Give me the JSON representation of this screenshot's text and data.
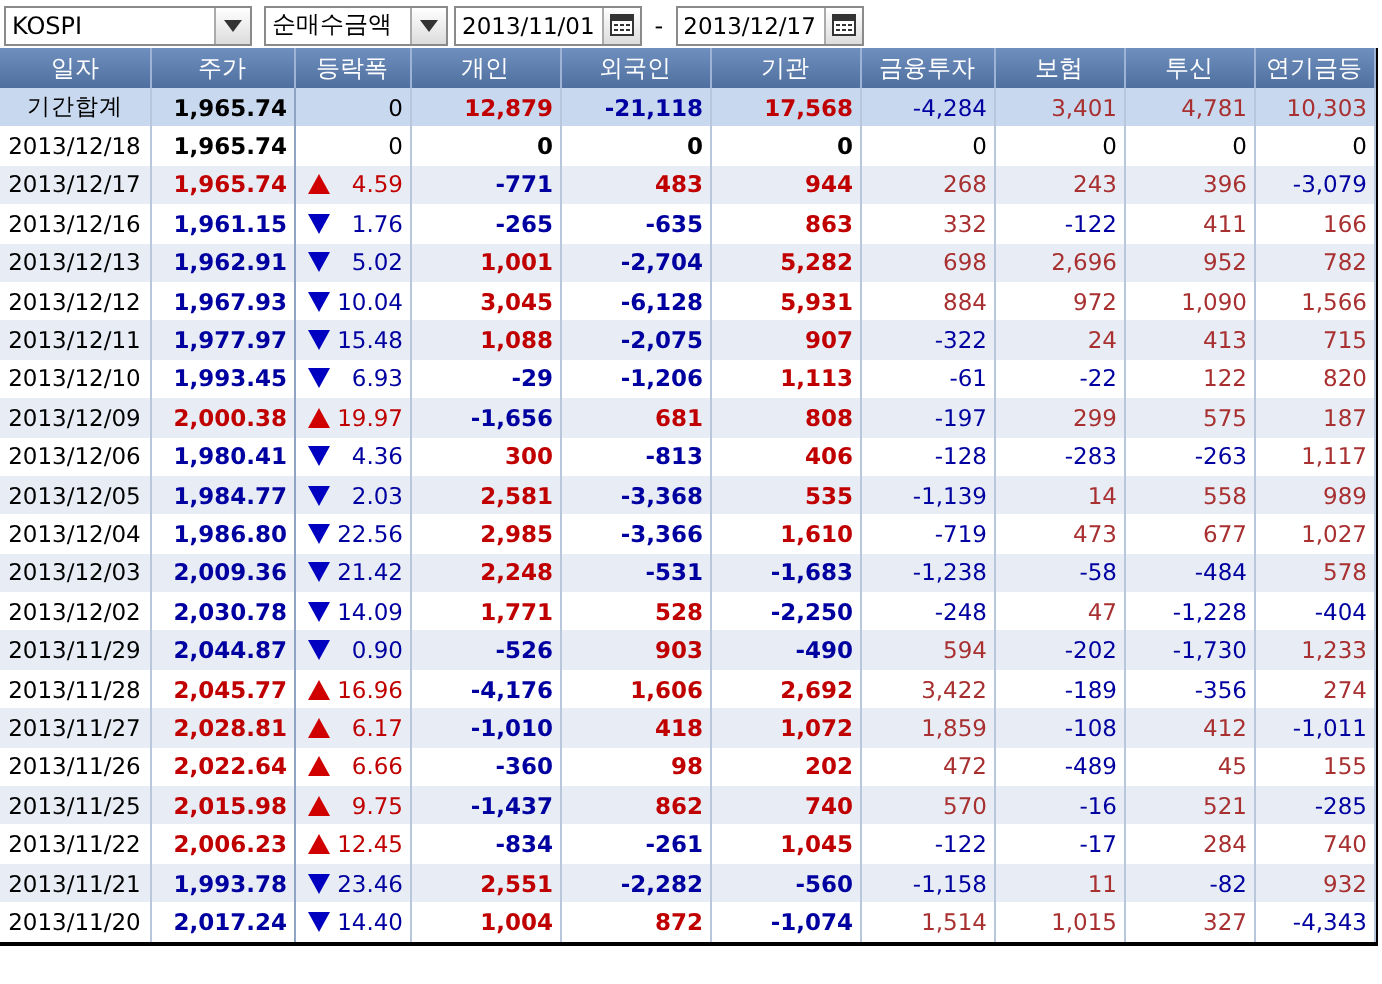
{
  "toolbar": {
    "market": "KOSPI",
    "measure": "순매수금액",
    "start_date": "2013/11/01",
    "separator": "-",
    "end_date": "2013/12/17"
  },
  "table": {
    "columns": [
      "일자",
      "주가",
      "등락폭",
      "개인",
      "외국인",
      "기관",
      "금융투자",
      "보험",
      "투신",
      "연기금등"
    ],
    "summary": {
      "label": "기간합계",
      "price": "1,965.74",
      "change": "0",
      "values": [
        "12,879",
        "-21,118",
        "17,568",
        "-4,284",
        "3,401",
        "4,781",
        "10,303"
      ]
    },
    "rows": [
      {
        "date": "2013/12/18",
        "price": "1,965.74",
        "kind": "flat",
        "change": "0",
        "values": [
          "0",
          "0",
          "0",
          "0",
          "0",
          "0",
          "0"
        ]
      },
      {
        "date": "2013/12/17",
        "price": "1,965.74",
        "kind": "up",
        "change": "4.59",
        "values": [
          "-771",
          "483",
          "944",
          "268",
          "243",
          "396",
          "-3,079"
        ]
      },
      {
        "date": "2013/12/16",
        "price": "1,961.15",
        "kind": "down",
        "change": "1.76",
        "values": [
          "-265",
          "-635",
          "863",
          "332",
          "-122",
          "411",
          "166"
        ]
      },
      {
        "date": "2013/12/13",
        "price": "1,962.91",
        "kind": "down",
        "change": "5.02",
        "values": [
          "1,001",
          "-2,704",
          "5,282",
          "698",
          "2,696",
          "952",
          "782"
        ]
      },
      {
        "date": "2013/12/12",
        "price": "1,967.93",
        "kind": "down",
        "change": "10.04",
        "values": [
          "3,045",
          "-6,128",
          "5,931",
          "884",
          "972",
          "1,090",
          "1,566"
        ]
      },
      {
        "date": "2013/12/11",
        "price": "1,977.97",
        "kind": "down",
        "change": "15.48",
        "values": [
          "1,088",
          "-2,075",
          "907",
          "-322",
          "24",
          "413",
          "715"
        ]
      },
      {
        "date": "2013/12/10",
        "price": "1,993.45",
        "kind": "down",
        "change": "6.93",
        "values": [
          "-29",
          "-1,206",
          "1,113",
          "-61",
          "-22",
          "122",
          "820"
        ]
      },
      {
        "date": "2013/12/09",
        "price": "2,000.38",
        "kind": "up",
        "change": "19.97",
        "values": [
          "-1,656",
          "681",
          "808",
          "-197",
          "299",
          "575",
          "187"
        ]
      },
      {
        "date": "2013/12/06",
        "price": "1,980.41",
        "kind": "down",
        "change": "4.36",
        "values": [
          "300",
          "-813",
          "406",
          "-128",
          "-283",
          "-263",
          "1,117"
        ]
      },
      {
        "date": "2013/12/05",
        "price": "1,984.77",
        "kind": "down",
        "change": "2.03",
        "values": [
          "2,581",
          "-3,368",
          "535",
          "-1,139",
          "14",
          "558",
          "989"
        ]
      },
      {
        "date": "2013/12/04",
        "price": "1,986.80",
        "kind": "down",
        "change": "22.56",
        "values": [
          "2,985",
          "-3,366",
          "1,610",
          "-719",
          "473",
          "677",
          "1,027"
        ]
      },
      {
        "date": "2013/12/03",
        "price": "2,009.36",
        "kind": "down",
        "change": "21.42",
        "values": [
          "2,248",
          "-531",
          "-1,683",
          "-1,238",
          "-58",
          "-484",
          "578"
        ]
      },
      {
        "date": "2013/12/02",
        "price": "2,030.78",
        "kind": "down",
        "change": "14.09",
        "values": [
          "1,771",
          "528",
          "-2,250",
          "-248",
          "47",
          "-1,228",
          "-404"
        ]
      },
      {
        "date": "2013/11/29",
        "price": "2,044.87",
        "kind": "down",
        "change": "0.90",
        "values": [
          "-526",
          "903",
          "-490",
          "594",
          "-202",
          "-1,730",
          "1,233"
        ]
      },
      {
        "date": "2013/11/28",
        "price": "2,045.77",
        "kind": "up",
        "change": "16.96",
        "values": [
          "-4,176",
          "1,606",
          "2,692",
          "3,422",
          "-189",
          "-356",
          "274"
        ]
      },
      {
        "date": "2013/11/27",
        "price": "2,028.81",
        "kind": "up",
        "change": "6.17",
        "values": [
          "-1,010",
          "418",
          "1,072",
          "1,859",
          "-108",
          "412",
          "-1,011"
        ]
      },
      {
        "date": "2013/11/26",
        "price": "2,022.64",
        "kind": "up",
        "change": "6.66",
        "values": [
          "-360",
          "98",
          "202",
          "472",
          "-489",
          "45",
          "155"
        ]
      },
      {
        "date": "2013/11/25",
        "price": "2,015.98",
        "kind": "up",
        "change": "9.75",
        "values": [
          "-1,437",
          "862",
          "740",
          "570",
          "-16",
          "521",
          "-285"
        ]
      },
      {
        "date": "2013/11/22",
        "price": "2,006.23",
        "kind": "up",
        "change": "12.45",
        "values": [
          "-834",
          "-261",
          "1,045",
          "-122",
          "-17",
          "284",
          "740"
        ]
      },
      {
        "date": "2013/11/21",
        "price": "1,993.78",
        "kind": "down",
        "change": "23.46",
        "values": [
          "2,551",
          "-2,282",
          "-560",
          "-1,158",
          "11",
          "-82",
          "932"
        ]
      },
      {
        "date": "2013/11/20",
        "price": "2,017.24",
        "kind": "down",
        "change": "14.40",
        "values": [
          "1,004",
          "872",
          "-1,074",
          "1,514",
          "1,015",
          "327",
          "-4,343"
        ]
      }
    ]
  }
}
